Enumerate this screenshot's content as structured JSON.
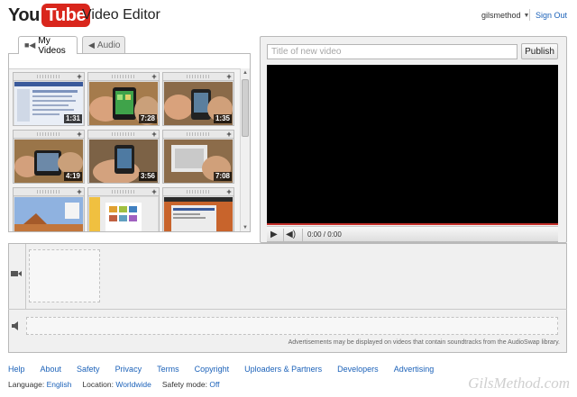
{
  "header": {
    "logo_you": "You",
    "logo_tube": "Tube",
    "app_title": "Video Editor",
    "username": "gilsmethod",
    "sign_out": "Sign Out"
  },
  "library": {
    "tabs": [
      {
        "label": "My Videos",
        "icon": "camera-icon",
        "active": true
      },
      {
        "label": "Audio",
        "icon": "speaker-icon",
        "active": false
      }
    ],
    "thumbnails": [
      {
        "duration": "1:31",
        "scene": "screenshot"
      },
      {
        "duration": "7:28",
        "scene": "phone-green"
      },
      {
        "duration": "1:35",
        "scene": "phone-hands"
      },
      {
        "duration": "4:19",
        "scene": "phone-table"
      },
      {
        "duration": "3:56",
        "scene": "phone-hold"
      },
      {
        "duration": "7:08",
        "scene": "phone-box"
      },
      {
        "duration": "",
        "scene": "desktop-sky"
      },
      {
        "duration": "",
        "scene": "screenshot-tiles"
      },
      {
        "duration": "",
        "scene": "desktop-orange"
      }
    ],
    "add_symbol": "+"
  },
  "preview": {
    "title_placeholder": "Title of new video",
    "publish_label": "Publish",
    "time": "0:00 / 0:00"
  },
  "timeline": {
    "ads_note": "Advertisements may be displayed on videos that contain soundtracks from the AudioSwap library."
  },
  "footer": {
    "links": [
      "Help",
      "About",
      "Safety",
      "Privacy",
      "Terms",
      "Copyright",
      "Uploaders & Partners",
      "Developers",
      "Advertising"
    ],
    "language_label": "Language:",
    "language_value": "English",
    "location_label": "Location:",
    "location_value": "Worldwide",
    "safety_label": "Safety mode:",
    "safety_value": "Off"
  },
  "watermark": "GilsMethod.com",
  "colors": {
    "brand_red": "#d9261c",
    "link_blue": "#1c62b9",
    "progress_red": "#c4302b"
  }
}
